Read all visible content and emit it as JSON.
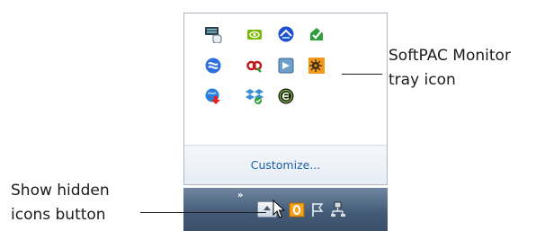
{
  "overflow_panel": {
    "icons": [
      {
        "name": "keyboard-mouse-icon"
      },
      {
        "name": "nvidia-icon"
      },
      {
        "name": "blue-network-icon"
      },
      {
        "name": "green-sync-icon"
      },
      {
        "name": "blue-s-logo-icon"
      },
      {
        "name": "red-chain-icon"
      },
      {
        "name": "blue-arrow-box-icon"
      },
      {
        "name": "softpac-monitor-icon"
      },
      {
        "name": "globe-down-arrow-icon"
      },
      {
        "name": "dropbox-icon"
      },
      {
        "name": "black-e-circle-icon"
      }
    ],
    "customize_label": "Customize..."
  },
  "taskbar": {
    "chevrons": "»",
    "show_hidden_button": "show-hidden-icons-button",
    "tray_icons": [
      "office-reminder-icon",
      "action-center-flag-icon",
      "network-icon"
    ]
  },
  "callouts": {
    "softpac": {
      "line1": "SoftPAC Monitor",
      "line2": "tray icon"
    },
    "show_hidden": {
      "line1": "Show hidden",
      "line2": "icons button"
    }
  },
  "colors": {
    "link": "#1a5fa7",
    "taskbar_top": "#6f86a0",
    "taskbar_bottom": "#3a4f69",
    "panel_border": "#aeb6c2"
  }
}
